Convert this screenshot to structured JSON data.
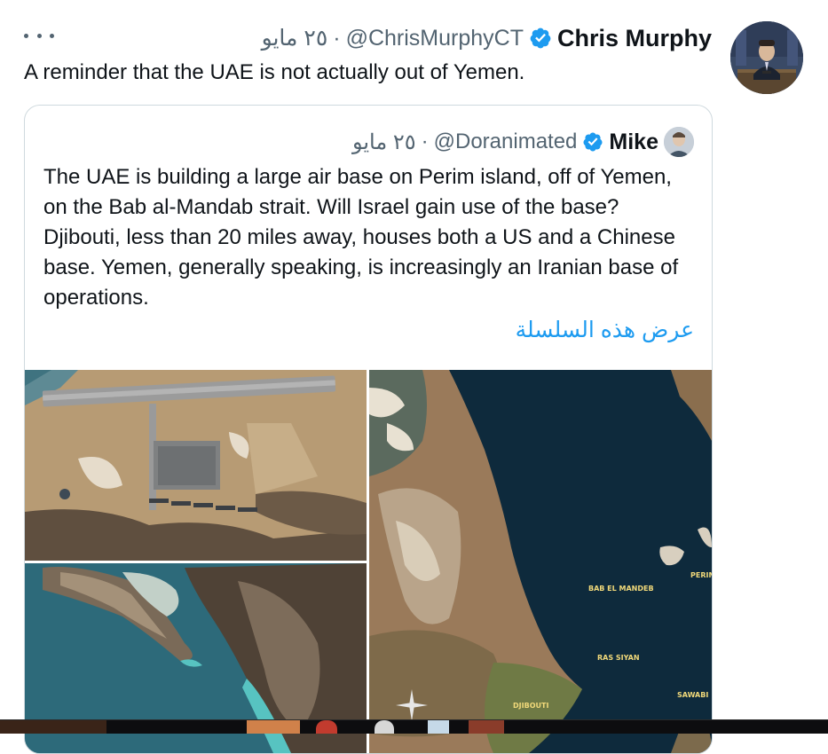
{
  "tweet": {
    "author_name": "Chris Murphy",
    "handle": "@ChrisMurphyCT",
    "separator": "·",
    "date": "٢٥ مايو",
    "text": "A reminder that the UAE is not actually out of Yemen.",
    "more_icon": "more-dots-icon",
    "verified_icon": "verified-badge-icon"
  },
  "quote": {
    "author_name": "Mike",
    "handle": "@Doranimated",
    "separator": "·",
    "date": "٢٥ مايو",
    "text": "The UAE is building a large air base on Perim island, off of Yemen, on the Bab al-Mandab strait. Will Israel gain use of the base? Djibouti, less than 20 miles away, houses both a US and a Chinese base. Yemen, generally speaking, is increasingly an Iranian base of operations.",
    "show_thread": "عرض هذه السلسلة"
  },
  "map_labels": {
    "bab_el_mandeb": "BAB EL MANDEB",
    "perim": "PERIM",
    "ras_siyan": "RAS SIYAN",
    "djibouti": "DJIBOUTI",
    "sawabi": "SAWABI"
  },
  "colors": {
    "link": "#1d9bf0",
    "secondary_text": "#536471",
    "border": "#cfd9de"
  }
}
